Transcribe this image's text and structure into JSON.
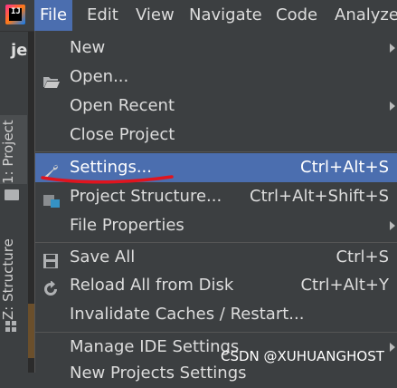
{
  "menubar": {
    "items": [
      "File",
      "Edit",
      "View",
      "Navigate",
      "Code",
      "Analyze"
    ]
  },
  "project": {
    "name": "jed"
  },
  "sidebar": {
    "project_tab": "1: Project",
    "structure_tab": "Z: Structure"
  },
  "file_menu": {
    "new": "New",
    "open": "Open...",
    "open_recent": "Open Recent",
    "close_project": "Close Project",
    "settings": "Settings...",
    "settings_shortcut": "Ctrl+Alt+S",
    "project_structure": "Project Structure...",
    "project_structure_shortcut": "Ctrl+Alt+Shift+S",
    "file_properties": "File Properties",
    "save_all": "Save All",
    "save_all_shortcut": "Ctrl+S",
    "reload_all": "Reload All from Disk",
    "reload_all_shortcut": "Ctrl+Alt+Y",
    "invalidate_caches": "Invalidate Caches / Restart...",
    "manage_ide_settings": "Manage IDE Settings",
    "new_projects_settings": "New Projects Settings"
  },
  "watermark": "CSDN @XUHUANGHOST",
  "colors": {
    "background": "#3c3f41",
    "selection": "#4b6eaf",
    "annotation_red": "#e0141e"
  }
}
